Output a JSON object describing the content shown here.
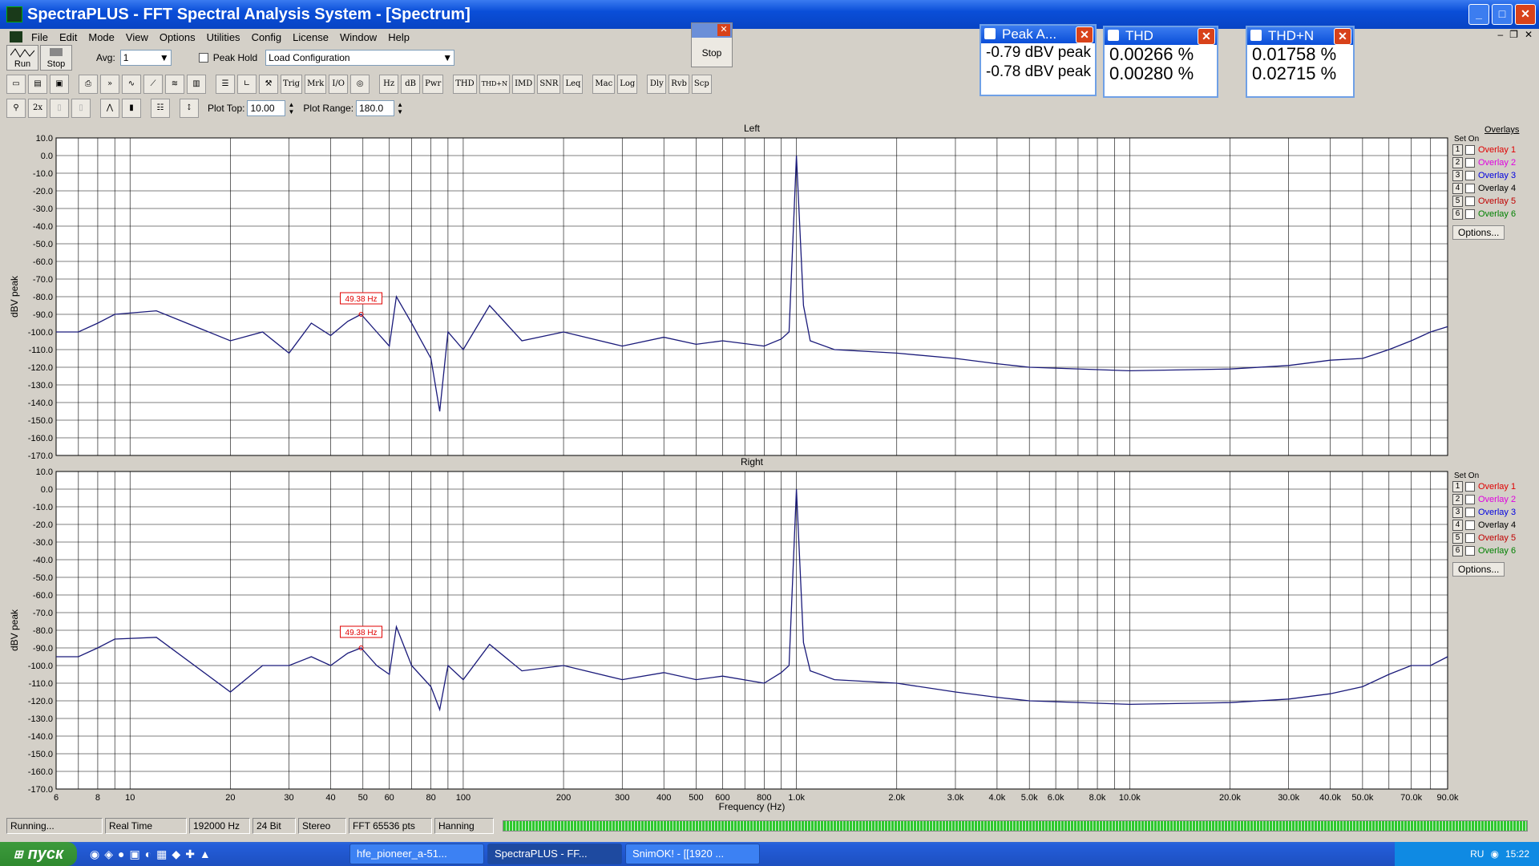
{
  "window": {
    "title": "SpectraPLUS - FFT Spectral Analysis System - [Spectrum]"
  },
  "menu": [
    "File",
    "Edit",
    "Mode",
    "View",
    "Options",
    "Utilities",
    "Config",
    "License",
    "Window",
    "Help"
  ],
  "toolbar1": {
    "run": "Run",
    "stop": "Stop",
    "avg_label": "Avg:",
    "avg_value": "1",
    "peak_hold": "Peak Hold",
    "load_config": "Load Configuration"
  },
  "toolbar2": [
    "Trig",
    "Mrk",
    "I/O",
    "Hz",
    "dB",
    "Pwr",
    "THD",
    "THD+N",
    "IMD",
    "SNR",
    "Leq",
    "Mac",
    "Log",
    "Dly",
    "Rvb",
    "Scp"
  ],
  "toolbar3": {
    "plot_top_label": "Plot Top:",
    "plot_top": "10.00",
    "plot_range_label": "Plot Range:",
    "plot_range": "180.0"
  },
  "stop_panel": {
    "label": "Stop"
  },
  "meters": {
    "peak": {
      "title": "Peak A...",
      "v1": "-0.79 dBV peak",
      "v2": "-0.78 dBV peak"
    },
    "thd": {
      "title": "THD",
      "v1": "0.00266 %",
      "v2": "0.00280 %"
    },
    "thdn": {
      "title": "THD+N",
      "v1": "0.01758 %",
      "v2": "0.02715 %"
    }
  },
  "overlays": {
    "heading": "Overlays",
    "set_label": "Set",
    "on_label": "On",
    "items": [
      "Overlay 1",
      "Overlay 2",
      "Overlay 3",
      "Overlay 4",
      "Overlay 5",
      "Overlay 6"
    ],
    "numbers": [
      "1",
      "2",
      "3",
      "4",
      "5",
      "6"
    ],
    "colors": [
      "#e00000",
      "#e000e0",
      "#0000e0",
      "#000000",
      "#c00000",
      "#008000"
    ],
    "options": "Options..."
  },
  "status": [
    "Running...",
    "Real Time",
    "192000 Hz",
    "24 Bit",
    "Stereo",
    "FFT 65536 pts",
    "Hanning"
  ],
  "taskbar": {
    "start": "пуск",
    "tasks": [
      "hfe_pioneer_a-51...",
      "SpectraPLUS - FF...",
      "SnimOK! - [[1920 ..."
    ],
    "lang": "RU",
    "time": "15:22"
  },
  "chart_data": [
    {
      "type": "line",
      "title": "Left",
      "ylabel": "dBV peak",
      "xlabel": "Frequency (Hz)",
      "xscale": "log",
      "xlim": [
        6,
        90000
      ],
      "ylim": [
        -170,
        10
      ],
      "marker": "49.38 Hz",
      "x": [
        6,
        7,
        8,
        9,
        12,
        20,
        25,
        30,
        35,
        40,
        45,
        49.38,
        55,
        60,
        63,
        70,
        80,
        85,
        90,
        100,
        120,
        150,
        200,
        300,
        400,
        500,
        600,
        800,
        900,
        950,
        1000,
        1050,
        1100,
        1300,
        2000,
        3000,
        4000,
        5000,
        10000,
        20000,
        30000,
        40000,
        50000,
        60000,
        70000,
        80000,
        90000
      ],
      "values": [
        -100,
        -100,
        -95,
        -90,
        -88,
        -105,
        -100,
        -112,
        -95,
        -102,
        -94,
        -90,
        -100,
        -108,
        -80,
        -95,
        -115,
        -145,
        -100,
        -110,
        -85,
        -105,
        -100,
        -108,
        -103,
        -107,
        -105,
        -108,
        -104,
        -100,
        0,
        -85,
        -105,
        -110,
        -112,
        -115,
        -118,
        -120,
        -122,
        -121,
        -119,
        -116,
        -115,
        -110,
        -105,
        -100,
        -97
      ]
    },
    {
      "type": "line",
      "title": "Right",
      "ylabel": "dBV peak",
      "xlabel": "Frequency (Hz)",
      "xscale": "log",
      "xlim": [
        6,
        90000
      ],
      "ylim": [
        -170,
        10
      ],
      "marker": "49.38 Hz",
      "x": [
        6,
        7,
        8,
        9,
        12,
        20,
        25,
        30,
        35,
        40,
        45,
        49.38,
        55,
        60,
        63,
        70,
        80,
        85,
        90,
        100,
        120,
        150,
        200,
        300,
        400,
        500,
        600,
        800,
        900,
        950,
        1000,
        1050,
        1100,
        1300,
        2000,
        3000,
        4000,
        5000,
        10000,
        20000,
        30000,
        40000,
        50000,
        60000,
        70000,
        80000,
        90000
      ],
      "values": [
        -95,
        -95,
        -90,
        -85,
        -84,
        -115,
        -100,
        -100,
        -95,
        -100,
        -93,
        -90,
        -100,
        -105,
        -78,
        -100,
        -112,
        -125,
        -100,
        -108,
        -88,
        -103,
        -100,
        -108,
        -104,
        -108,
        -106,
        -110,
        -104,
        -100,
        0,
        -87,
        -103,
        -108,
        -110,
        -115,
        -118,
        -120,
        -122,
        -121,
        -119,
        -116,
        -112,
        -105,
        -100,
        -100,
        -95
      ]
    }
  ],
  "axis": {
    "yticks": [
      "10.0",
      "0.0",
      "-10.0",
      "-20.0",
      "-30.0",
      "-40.0",
      "-50.0",
      "-60.0",
      "-70.0",
      "-80.0",
      "-90.0",
      "-100.0",
      "-110.0",
      "-120.0",
      "-130.0",
      "-140.0",
      "-150.0",
      "-160.0",
      "-170.0"
    ],
    "xticks": [
      "6",
      "8",
      "10",
      "20",
      "30",
      "40",
      "50",
      "60",
      "80",
      "100",
      "200",
      "300",
      "400",
      "500",
      "600",
      "800",
      "1.0k",
      "2.0k",
      "3.0k",
      "4.0k",
      "5.0k",
      "6.0k",
      "8.0k",
      "10.0k",
      "20.0k",
      "30.0k",
      "40.0k",
      "50.0k",
      "70.0k",
      "90.0k"
    ],
    "xtick_values": [
      6,
      8,
      10,
      20,
      30,
      40,
      50,
      60,
      80,
      100,
      200,
      300,
      400,
      500,
      600,
      800,
      1000,
      2000,
      3000,
      4000,
      5000,
      6000,
      8000,
      10000,
      20000,
      30000,
      40000,
      50000,
      70000,
      90000
    ]
  }
}
